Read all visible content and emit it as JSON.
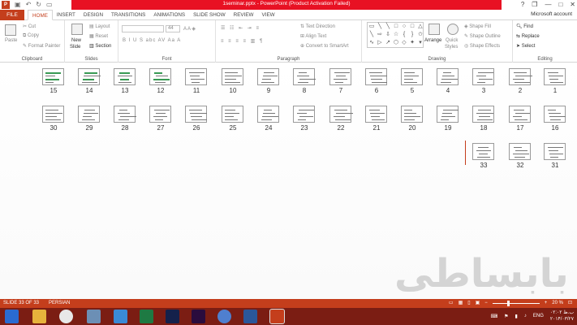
{
  "titlebar": {
    "title": "1seminar.pptx -  PowerPoint (Product Activation Failed)",
    "qat_icons": [
      "powerpoint-icon",
      "save-icon",
      "undo-icon",
      "redo-icon",
      "present-icon"
    ],
    "controls": [
      "?",
      "❐",
      "—",
      "□",
      "✕"
    ]
  },
  "tabs": {
    "file": "FILE",
    "items": [
      "HOME",
      "INSERT",
      "DESIGN",
      "TRANSITIONS",
      "ANIMATIONS",
      "SLIDE SHOW",
      "REVIEW",
      "VIEW"
    ],
    "active": "HOME",
    "account": "Microsoft account"
  },
  "ribbon": {
    "clipboard": {
      "label": "Clipboard",
      "paste": "Paste",
      "cut": "Cut",
      "copy": "Copy",
      "format_painter": "Format Painter"
    },
    "slides": {
      "label": "Slides",
      "new_slide": "New",
      "new_slide2": "Slide",
      "layout": "Layout",
      "reset": "Reset",
      "section": "Section"
    },
    "font": {
      "label": "Font",
      "font_size": "44",
      "buttons": "B  I  U  S  abc  AV  Aa  A"
    },
    "paragraph": {
      "label": "Paragraph",
      "text_direction": "Text Direction",
      "align_text": "Align Text",
      "convert_smartart": "Convert to SmartArt"
    },
    "drawing": {
      "label": "Drawing",
      "arrange": "Arrange",
      "quick_styles": "Quick",
      "quick_styles2": "Styles",
      "shape_fill": "Shape Fill",
      "shape_outline": "Shape Outline",
      "shape_effects": "Shape Effects"
    },
    "editing": {
      "label": "Editing",
      "find": "Find",
      "replace": "Replace",
      "select": "Select"
    }
  },
  "slides": {
    "row1": [
      "15",
      "14",
      "13",
      "12",
      "11",
      "10",
      "9",
      "8",
      "7",
      "6",
      "5",
      "4",
      "3",
      "2",
      "1"
    ],
    "row2": [
      "30",
      "29",
      "28",
      "27",
      "26",
      "25",
      "24",
      "23",
      "22",
      "21",
      "20",
      "19",
      "18",
      "17",
      "16"
    ],
    "row3": [
      "33",
      "32",
      "31"
    ]
  },
  "watermark": "بابساطی",
  "status": {
    "slide_count": "SLIDE 33 OF 33",
    "language": "PERSIAN",
    "zoom": "20 %"
  },
  "taskbar": {
    "apps": [
      "file-explorer-icon",
      "chrome-icon",
      "network-icon",
      "sync-icon",
      "excel-icon",
      "photoshop-icon",
      "premiere-icon",
      "chat-icon",
      "word-icon",
      "powerpoint-icon"
    ],
    "lang": "ENG",
    "time": "۰۲:۰۲ ب.ظ",
    "date": "۲۰۱۴/۰۳/۲۷"
  },
  "colors": {
    "accent": "#c43e1c",
    "titlebar_band": "#e81123",
    "taskbar": "#7b1d13"
  }
}
